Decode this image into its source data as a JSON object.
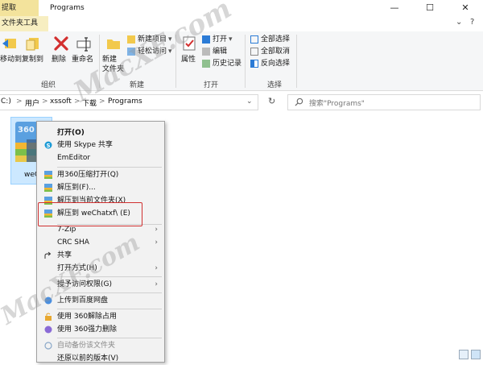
{
  "titlebar": {
    "context_tab": "提取",
    "title": "Programs",
    "minimize": "—",
    "maximize": "☐",
    "close": "✕"
  },
  "ribbon_tabs": {
    "tools_tab": "文件夹工具",
    "collapse": "⌄",
    "help": "?"
  },
  "ribbon": {
    "organize": {
      "move_to": "移动到",
      "copy_to": "复制到",
      "delete": "删除",
      "rename": "重命名",
      "label": "组织"
    },
    "new": {
      "new_folder": "新建\n文件夹",
      "new_item": "新建项目",
      "easy_access": "轻松访问",
      "label": "新建"
    },
    "open": {
      "properties": "属性",
      "open": "打开",
      "edit": "编辑",
      "history": "历史记录",
      "label": "打开"
    },
    "select": {
      "select_all": "全部选择",
      "select_none": "全部取消",
      "invert": "反向选择",
      "label": "选择"
    }
  },
  "address": {
    "crumbs": [
      "C:)",
      "用户",
      "xssoft",
      "下载",
      "Programs"
    ],
    "separator": ">",
    "dropdown": "⌄",
    "refresh": "↻",
    "search_placeholder": "搜索\"Programs\""
  },
  "file": {
    "name": "weC",
    "icon_text": "360"
  },
  "context_menu": {
    "items": [
      {
        "label": "打开(O)",
        "bold": true
      },
      {
        "label": "使用 Skype 共享"
      },
      {
        "label": "EmEditor"
      },
      {
        "label": "用360压缩打开(Q)"
      },
      {
        "label": "解压到(F)..."
      },
      {
        "label": "解压到当前文件夹(X)"
      },
      {
        "label": "解压到 weChatxf\\ (E)"
      },
      {
        "label": "7-Zip"
      },
      {
        "label": "CRC SHA"
      },
      {
        "label": "共享"
      },
      {
        "label": "打开方式(H)"
      },
      {
        "label": "授予访问权限(G)"
      },
      {
        "label": "上传到百度网盘"
      },
      {
        "label": "使用 360解除占用"
      },
      {
        "label": "使用 360强力删除"
      },
      {
        "label": "自动备份该文件夹"
      },
      {
        "label": "还原以前的版本(V)"
      }
    ],
    "submenu_arrow": "›"
  },
  "watermark": {
    "text": "MacXF.com"
  },
  "colors": {
    "context_tab": "#f3e39c",
    "selection": "#cce8ff",
    "highlight": "#d03030",
    "menu_bg": "#f2f2f2"
  }
}
